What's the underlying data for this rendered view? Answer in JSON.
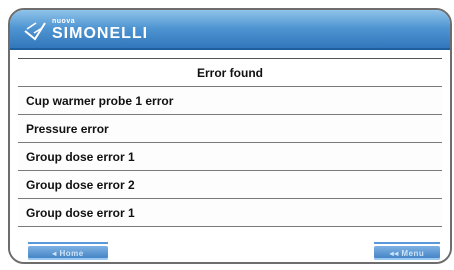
{
  "brand": {
    "small": "nuova",
    "name": "SIMONELLI"
  },
  "panel": {
    "title": "Error found",
    "errors": [
      "Cup warmer probe 1 error",
      "Pressure error",
      "Group dose error 1",
      "Group dose error 2",
      "Group dose error 1"
    ]
  },
  "footer": {
    "left_button": "◂ Home",
    "right_button": "◂◂ Menu"
  },
  "colors": {
    "header_top": "#8fc3ea",
    "header_bottom": "#2f74b9",
    "button": "#3d7ec2"
  }
}
